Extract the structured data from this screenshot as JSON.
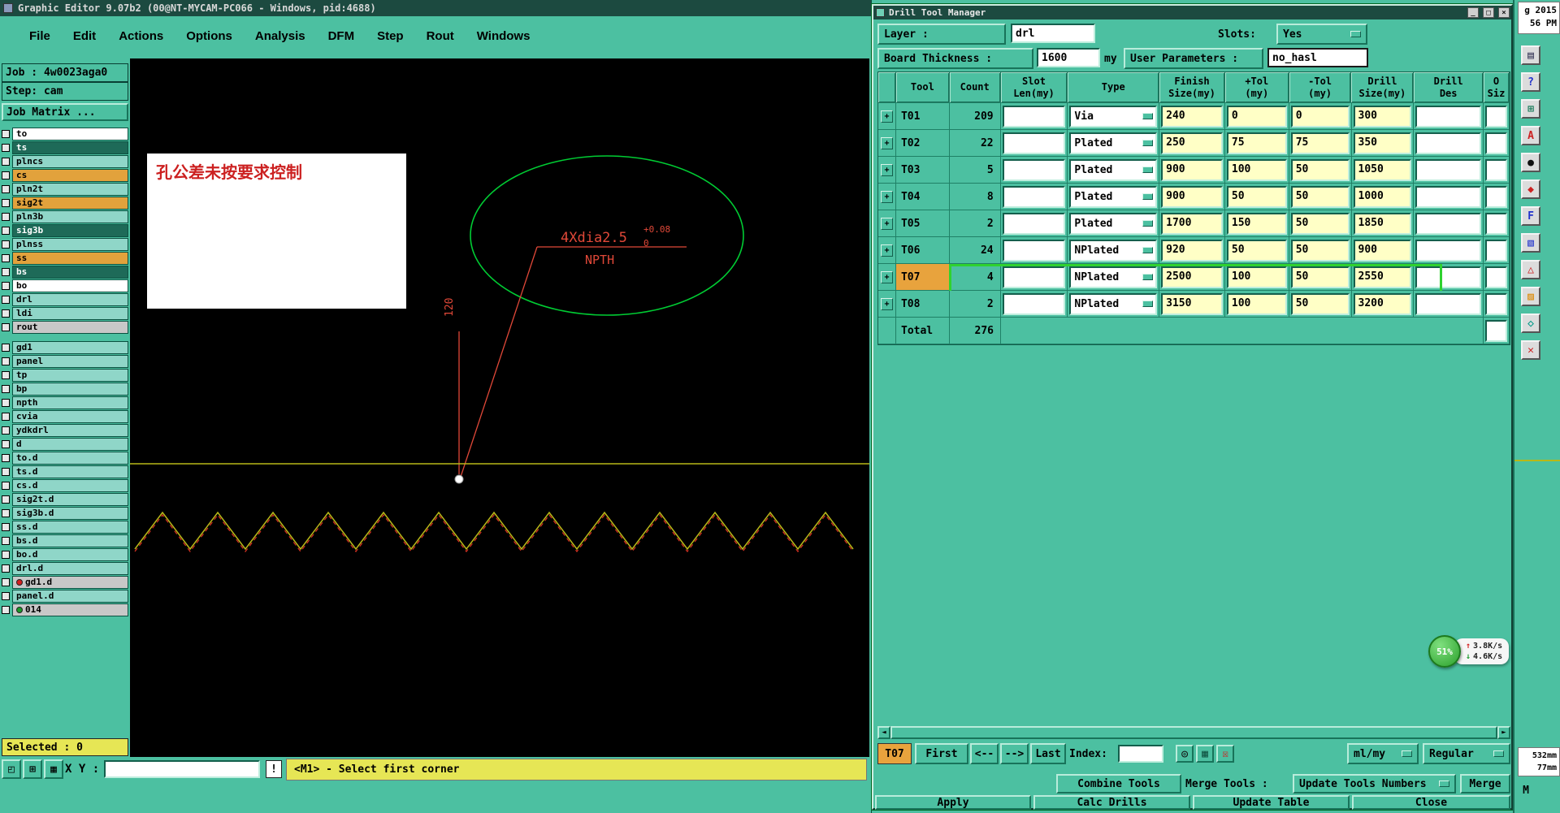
{
  "editor": {
    "title": "Graphic Editor 9.07b2 (00@NT-MYCAM-PC066 - Windows, pid:4688)",
    "menus": [
      {
        "label": "File"
      },
      {
        "label": "Edit"
      },
      {
        "label": "Actions"
      },
      {
        "label": "Options"
      },
      {
        "label": "Analysis"
      },
      {
        "label": "DFM"
      },
      {
        "label": "Step"
      },
      {
        "label": "Rout"
      },
      {
        "label": "Windows"
      }
    ],
    "job": "Job : 4w0023aga0",
    "step": "Step: cam",
    "job_matrix": "Job Matrix ...",
    "layers": [
      {
        "name": "to",
        "color": "c-white"
      },
      {
        "name": "ts",
        "color": "c-dark"
      },
      {
        "name": "plncs",
        "color": "c-teal"
      },
      {
        "name": "cs",
        "color": "c-orange"
      },
      {
        "name": "pln2t",
        "color": "c-teal"
      },
      {
        "name": "sig2t",
        "color": "c-orange"
      },
      {
        "name": "pln3b",
        "color": "c-teal"
      },
      {
        "name": "sig3b",
        "color": "c-dark"
      },
      {
        "name": "plnss",
        "color": "c-teal"
      },
      {
        "name": "ss",
        "color": "c-orange"
      },
      {
        "name": "bs",
        "color": "c-dark"
      },
      {
        "name": "bo",
        "color": "c-white"
      },
      {
        "name": "drl",
        "color": "c-teal"
      },
      {
        "name": "ldi",
        "color": "c-teal"
      },
      {
        "name": "rout",
        "color": "c-grey",
        "gap_after": "gap"
      },
      {
        "name": "gd1",
        "color": "c-teal"
      },
      {
        "name": "panel",
        "color": "c-teal"
      },
      {
        "name": "tp",
        "color": "c-teal"
      },
      {
        "name": "bp",
        "color": "c-teal"
      },
      {
        "name": "npth",
        "color": "c-teal"
      },
      {
        "name": "cvia",
        "color": "c-teal"
      },
      {
        "name": "ydkdrl",
        "color": "c-teal"
      },
      {
        "name": "d",
        "color": "c-teal"
      },
      {
        "name": "to.d",
        "color": "c-teal"
      },
      {
        "name": "ts.d",
        "color": "c-teal"
      },
      {
        "name": "cs.d",
        "color": "c-teal"
      },
      {
        "name": "sig2t.d",
        "color": "c-teal"
      },
      {
        "name": "sig3b.d",
        "color": "c-teal"
      },
      {
        "name": "ss.d",
        "color": "c-teal"
      },
      {
        "name": "bs.d",
        "color": "c-teal"
      },
      {
        "name": "bo.d",
        "color": "c-teal"
      },
      {
        "name": "drl.d",
        "color": "c-teal"
      },
      {
        "name": "gd1.d",
        "color": "c-grey",
        "dot": "dot-red"
      },
      {
        "name": "panel.d",
        "color": "c-teal"
      },
      {
        "name": "014",
        "color": "c-grey",
        "dot": "dot-green"
      }
    ],
    "canvas": {
      "note": "孔公差未按要求控制",
      "dim_label": "4Xdia2.5",
      "dim_tol_up": "+0.08",
      "dim_tol_dn": "0",
      "npth": "NPTH",
      "vdim": "120"
    },
    "selected": "Selected : 0",
    "xy_label": "X Y :",
    "xy_value": "",
    "prompt": "<M1> - Select first corner",
    "toolbar_icons": [
      {
        "glyph": "◰"
      },
      {
        "glyph": "⊞"
      },
      {
        "glyph": "▦"
      }
    ],
    "alert_icon": "!"
  },
  "drill": {
    "title": "Drill Tool Manager",
    "controls": {
      "min": "_",
      "max": "□",
      "close": "×"
    },
    "layer_label": "Layer :",
    "layer_value": "drl",
    "slots_label": "Slots:",
    "slots_value": "Yes",
    "thickness_label": "Board Thickness :",
    "thickness_value": "1600",
    "thickness_unit": "my",
    "params_label": "User Parameters :",
    "params_value": "no_hasl",
    "plus_icon": "+",
    "table": {
      "headers": [
        "Tool",
        "Count",
        "Slot\nLen(my)",
        "Type",
        "Finish\nSize(my)",
        "+Tol\n(my)",
        "-Tol\n(my)",
        "Drill\nSize(my)",
        "Drill\nDes",
        "O\nSiz"
      ],
      "rows": [
        {
          "tool": "T01",
          "count": "209",
          "slot_len": "",
          "type": "Via",
          "finish": "240",
          "ptol": "0",
          "ntol": "0",
          "drill": "300",
          "des": ""
        },
        {
          "tool": "T02",
          "count": "22",
          "slot_len": "",
          "type": "Plated",
          "finish": "250",
          "ptol": "75",
          "ntol": "75",
          "drill": "350",
          "des": ""
        },
        {
          "tool": "T03",
          "count": "5",
          "slot_len": "",
          "type": "Plated",
          "finish": "900",
          "ptol": "100",
          "ntol": "50",
          "drill": "1050",
          "des": ""
        },
        {
          "tool": "T04",
          "count": "8",
          "slot_len": "",
          "type": "Plated",
          "finish": "900",
          "ptol": "50",
          "ntol": "50",
          "drill": "1000",
          "des": ""
        },
        {
          "tool": "T05",
          "count": "2",
          "slot_len": "",
          "type": "Plated",
          "finish": "1700",
          "ptol": "150",
          "ntol": "50",
          "drill": "1850",
          "des": ""
        },
        {
          "tool": "T06",
          "count": "24",
          "slot_len": "",
          "type": "NPlated",
          "finish": "920",
          "ptol": "50",
          "ntol": "50",
          "drill": "900",
          "des": ""
        },
        {
          "tool": "T07",
          "count": "4",
          "slot_len": "",
          "type": "NPlated",
          "finish": "2500",
          "ptol": "100",
          "ntol": "50",
          "drill": "2550",
          "des": "",
          "cls": "selected"
        },
        {
          "tool": "T08",
          "count": "2",
          "slot_len": "",
          "type": "NPlated",
          "finish": "3150",
          "ptol": "100",
          "ntol": "50",
          "drill": "3200",
          "des": ""
        }
      ],
      "total_label": "Total",
      "total_count": "276"
    },
    "nav": {
      "current": "T07",
      "first": "First",
      "prev": "<--",
      "next": "-->",
      "last": "Last",
      "index_label": "Index:",
      "index_value": "",
      "icons": [
        {
          "glyph": "◎",
          "color": "#111111"
        },
        {
          "glyph": "▦",
          "color": "#115544"
        },
        {
          "glyph": "☒",
          "color": "#cc2222"
        }
      ],
      "units": "ml/my",
      "mode": "Regular"
    },
    "actions": {
      "combine": "Combine Tools",
      "merge_label": "Merge Tools :",
      "update_numbers": "Update Tools Numbers",
      "merge": "Merge",
      "apply": "Apply",
      "calc": "Calc Drills",
      "update_table": "Update Table",
      "close": "Close"
    }
  },
  "strip": {
    "clock_line1": "g 2015",
    "clock_line2": "56 PM",
    "icons": [
      {
        "glyph": "▤",
        "color": "#333355"
      },
      {
        "glyph": "?",
        "color": "#2233cc"
      },
      {
        "glyph": "⊞",
        "color": "#117755"
      },
      {
        "glyph": "A",
        "color": "#cc2222"
      },
      {
        "glyph": "●",
        "color": "#111111"
      },
      {
        "glyph": "◆",
        "color": "#cc2222"
      },
      {
        "glyph": "F",
        "color": "#2233cc"
      },
      {
        "glyph": "▧",
        "color": "#2233cc"
      },
      {
        "glyph": "△",
        "color": "#cc2222"
      },
      {
        "glyph": "▨",
        "color": "#dd8800"
      },
      {
        "glyph": "◇",
        "color": "#009988"
      },
      {
        "glyph": "✕",
        "color": "#cc2222"
      }
    ],
    "coord1": "532mm",
    "coord2": "77mm",
    "mode": "M"
  },
  "net": {
    "percent": "51%",
    "up_icon": "↑",
    "up": "3.8K/s",
    "down_icon": "↓",
    "down": "4.6K/s"
  }
}
